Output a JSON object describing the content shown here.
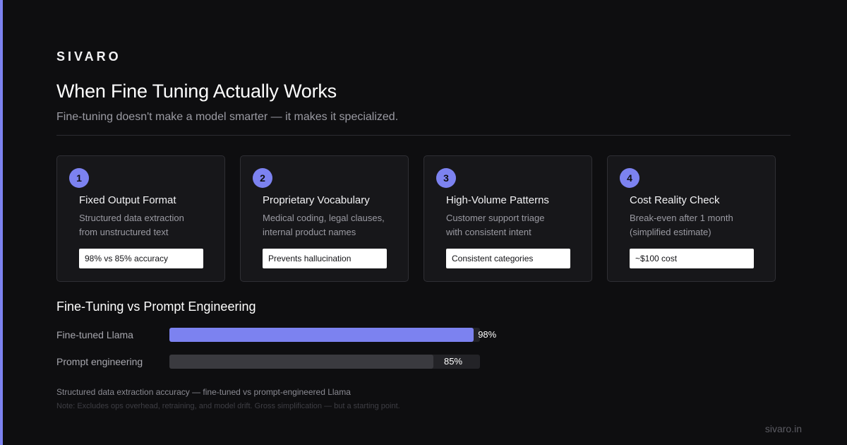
{
  "brand": "SIVARO",
  "title": "When Fine Tuning Actually Works",
  "subtitle": "Fine-tuning doesn't make a model smarter — it makes it specialized.",
  "colors": {
    "accent": "#7c82f0",
    "background": "#0e0e10",
    "card": "#17171a",
    "bar_muted": "#3a3a3f"
  },
  "cards": [
    {
      "number": "1",
      "title": "Fixed Output Format",
      "desc_lines": [
        "Structured data extraction",
        "from unstructured text"
      ],
      "tag": "98% vs 85% accuracy"
    },
    {
      "number": "2",
      "title": "Proprietary Vocabulary",
      "desc_lines": [
        "Medical coding, legal clauses,",
        "internal product names"
      ],
      "tag": "Prevents hallucination"
    },
    {
      "number": "3",
      "title": "High-Volume Patterns",
      "desc_lines": [
        "Customer support triage",
        "with consistent intent"
      ],
      "tag": "Consistent categories"
    },
    {
      "number": "4",
      "title": "Cost Reality Check",
      "desc_lines": [
        "Break-even after 1 month",
        "(simplified estimate)"
      ],
      "tag": "~$100 cost"
    }
  ],
  "comparison": {
    "title": "Fine-Tuning vs Prompt Engineering",
    "rows": [
      {
        "label": "Fine-tuned Llama",
        "value": 98,
        "display": "98%",
        "color": "#7c82f0"
      },
      {
        "label": "Prompt engineering",
        "value": 85,
        "display": "85%",
        "color": "#3a3a3f"
      }
    ],
    "max": 100
  },
  "caption": "Structured data extraction accuracy — fine-tuned vs prompt-engineered Llama",
  "note": "Note: Excludes ops overhead, retraining, and model drift. Gross simplification — but a starting point.",
  "footer_url": "sivaro.in"
}
